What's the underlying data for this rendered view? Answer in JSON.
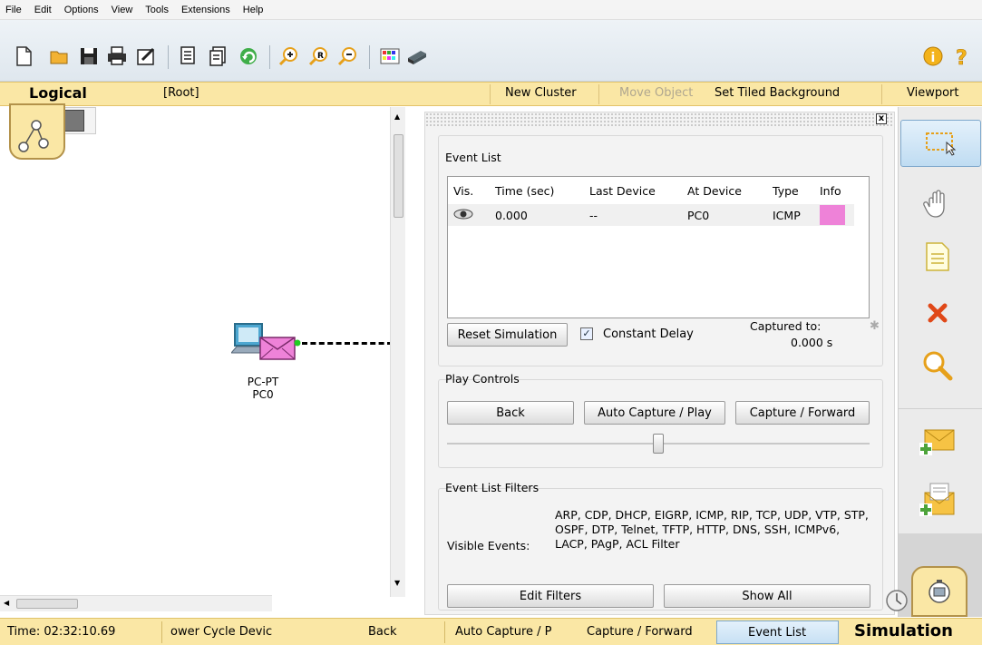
{
  "menu": [
    "File",
    "Edit",
    "Options",
    "View",
    "Tools",
    "Extensions",
    "Help"
  ],
  "toolbar_icons": [
    "new-icon",
    "open-icon",
    "save-icon",
    "print-icon",
    "activity-wizard-icon",
    "copy-icon",
    "paste-icon",
    "undo-icon",
    "zoom-in-icon",
    "zoom-reset-icon",
    "zoom-out-icon",
    "palette-icon",
    "custom-device-icon",
    "info-icon",
    "help-icon"
  ],
  "logical_bar": {
    "tab": "Logical",
    "root": "[Root]",
    "new_cluster": "New Cluster",
    "move_object": "Move Object",
    "set_tiled_background": "Set Tiled Background",
    "viewport": "Viewport"
  },
  "workspace": {
    "device_type": "PC-PT",
    "device_name": "PC0"
  },
  "sim_panel": {
    "close": "x",
    "event_list_title": "Event List",
    "columns": [
      "Vis.",
      "Time (sec)",
      "Last Device",
      "At Device",
      "Type",
      "Info"
    ],
    "rows": [
      {
        "time": "0.000",
        "last": "--",
        "at": "PC0",
        "type": "ICMP",
        "info_color": "#ee82d8"
      }
    ],
    "reset_simulation": "Reset Simulation",
    "constant_delay": "Constant Delay",
    "captured_to": "Captured to:",
    "captured_value": "0.000 s",
    "play_controls_title": "Play Controls",
    "back": "Back",
    "auto_capture": "Auto Capture / Play",
    "capture_forward": "Capture / Forward",
    "slider_value": 0.5,
    "filters_title": "Event List Filters",
    "visible_events_label": "Visible Events:",
    "visible_events_value": "ARP, CDP, DHCP, EIGRP, ICMP, RIP, TCP, UDP, VTP, STP, OSPF, DTP, Telnet, TFTP, HTTP, DNS, SSH, ICMPv6, LACP, PAgP, ACL Filter",
    "edit_filters": "Edit Filters",
    "show_all": "Show All"
  },
  "right_toolbar": [
    "select-icon",
    "move-layout-icon",
    "place-note-icon",
    "delete-icon",
    "inspect-icon",
    "add-simple-pdu-icon",
    "add-complex-pdu-icon"
  ],
  "statusbar": {
    "time": "Time: 02:32:10.69",
    "power_cycle": "ower Cycle Devic",
    "back": "Back",
    "auto_capture": "Auto Capture / P",
    "capture_forward": "Capture / Forward",
    "event_list": "Event List",
    "simulation": "Simulation"
  },
  "colors": {
    "bar": "#fae7a5",
    "pdu": "#ee82d8",
    "link": "#000000",
    "link_dot": "#22cc22"
  }
}
